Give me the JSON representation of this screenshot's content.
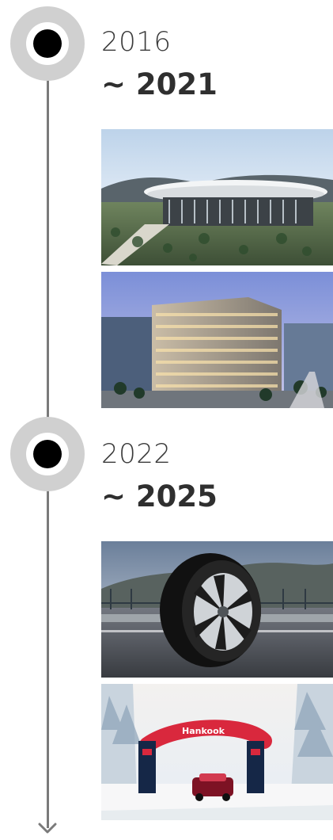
{
  "timeline": {
    "periods": [
      {
        "start": "2016",
        "end": "~ 2021"
      },
      {
        "start": "2022",
        "end": "~ 2025"
      }
    ]
  },
  "images": {
    "banner_text": "Hankook"
  },
  "colors": {
    "line": "#7a7a7a",
    "node_outer": "#cfcfcf",
    "node_inner": "#000000",
    "node_ring": "#ffffff",
    "text": "#333333"
  },
  "icons": {
    "timeline_node": "timeline-node-icon",
    "arrow": "arrow-down-icon"
  }
}
